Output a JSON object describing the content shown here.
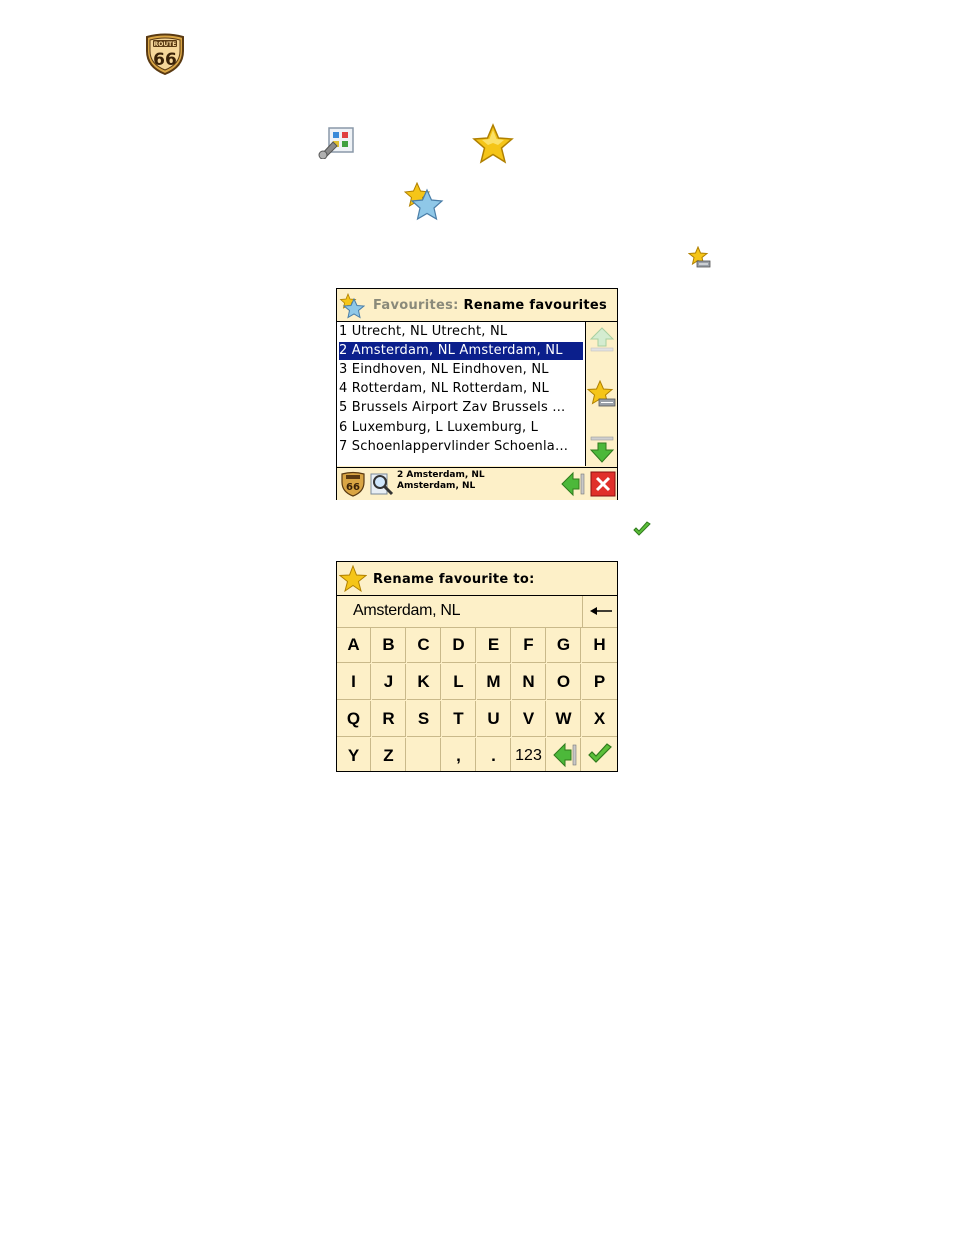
{
  "logo": {
    "top_text": "ROUTE",
    "number": "66"
  },
  "screen1": {
    "title_prefix": "Favourites:",
    "title_main": "Rename favourites",
    "items": [
      {
        "label": "1 Utrecht, NL Utrecht, NL",
        "selected": false
      },
      {
        "label": "2 Amsterdam, NL Amsterdam, NL",
        "selected": true
      },
      {
        "label": "3 Eindhoven, NL Eindhoven, NL",
        "selected": false
      },
      {
        "label": "4 Rotterdam, NL Rotterdam, NL",
        "selected": false
      },
      {
        "label": "5 Brussels Airport Zav Brussels …",
        "selected": false
      },
      {
        "label": "6 Luxemburg, L Luxemburg, L",
        "selected": false
      },
      {
        "label": "7 Schoenlappervlinder Schoenla…",
        "selected": false
      }
    ],
    "footer_line1": "2 Amsterdam, NL",
    "footer_line2": "Amsterdam, NL",
    "footer_logo_number": "66"
  },
  "screen2": {
    "title": "Rename favourite to:",
    "input_value": "Amsterdam, NL",
    "keys": [
      [
        "A",
        "B",
        "C",
        "D",
        "E",
        "F",
        "G",
        "H"
      ],
      [
        "I",
        "J",
        "K",
        "L",
        "M",
        "N",
        "O",
        "P"
      ],
      [
        "Q",
        "R",
        "S",
        "T",
        "U",
        "V",
        "W",
        "X"
      ],
      [
        "Y",
        "Z",
        "",
        ",",
        ".",
        "123"
      ]
    ]
  },
  "colors": {
    "panel_bg": "#fdf0c8",
    "selection": "#0b1f8c",
    "accent_green": "#3aa52c",
    "close_red": "#e0302a",
    "star_gold": "#f5c518",
    "star_blue": "#8fc8e8"
  }
}
